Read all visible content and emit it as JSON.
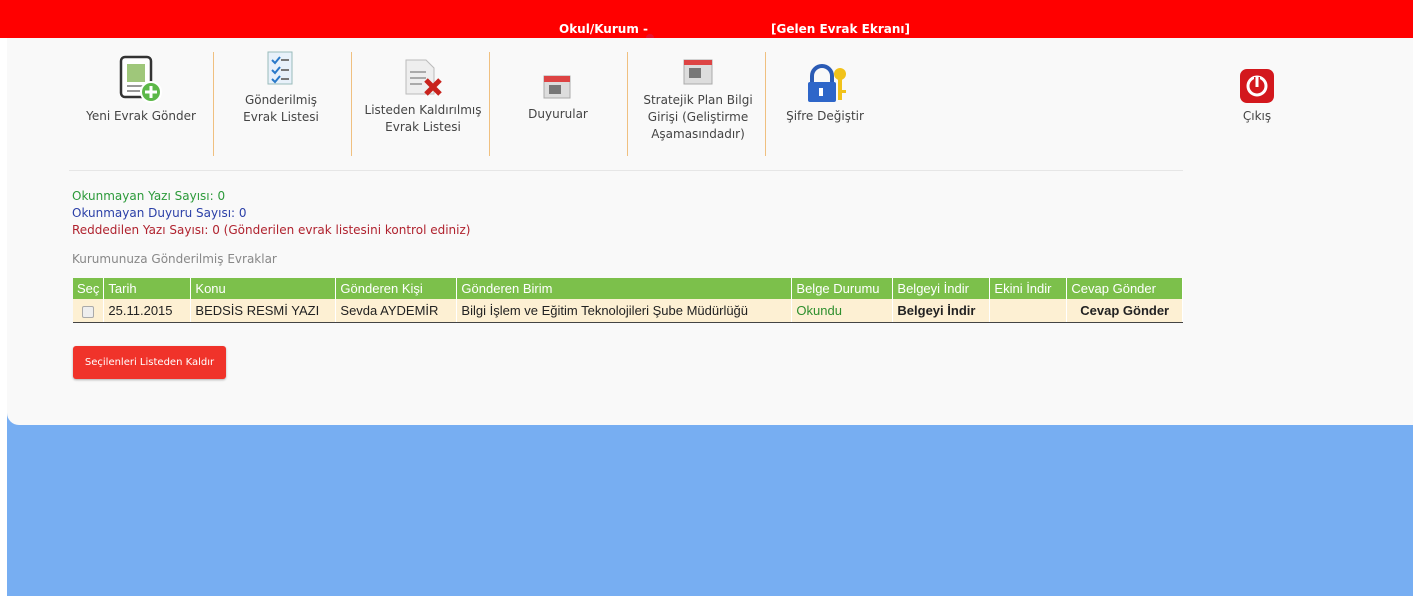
{
  "header": {
    "school_label": "Okul/Kurum -",
    "screen_label": "[Gelen Evrak Ekranı]"
  },
  "toolbar": {
    "items": [
      {
        "label": "Yeni Evrak Gönder",
        "icon": "new-document-plus-icon"
      },
      {
        "label": "Gönderilmiş Evrak Listesi",
        "icon": "checklist-document-icon"
      },
      {
        "label": "Listeden Kaldırılmış Evrak Listesi",
        "icon": "document-remove-icon"
      },
      {
        "label": "Duyurular",
        "icon": "announcement-icon"
      },
      {
        "label": "Stratejik Plan Bilgi Girişi (Geliştirme Aşamasındadır)",
        "icon": "strategic-plan-icon"
      },
      {
        "label": "Şifre Değiştir",
        "icon": "lock-key-icon"
      },
      {
        "label": "Çıkış",
        "icon": "power-icon"
      }
    ]
  },
  "stats": {
    "unread_docs": "Okunmayan Yazı Sayısı: 0",
    "unread_announcements": "Okunmayan Duyuru Sayısı: 0",
    "rejected": "Reddedilen Yazı Sayısı: 0 (Gönderilen evrak listesini kontrol ediniz)"
  },
  "table": {
    "caption": "Kurumunuza Gönderilmiş Evraklar",
    "headers": [
      "Seç",
      "Tarih",
      "Konu",
      "Gönderen Kişi",
      "Gönderen Birim",
      "Belge Durumu",
      "Belgeyi İndir",
      "Ekini İndir",
      "Cevap Gönder"
    ],
    "rows": [
      {
        "date": "25.11.2015",
        "subject": "BEDSİS RESMİ YAZI",
        "sender": "Sevda AYDEMİR",
        "unit": "Bilgi İşlem ve Eğitim Teknolojileri Şube Müdürlüğü",
        "status": "Okundu",
        "download": "Belgeyi İndir",
        "attachment": "",
        "reply": "Cevap Gönder"
      }
    ]
  },
  "remove_button": "Seçilenleri Listeden Kaldır",
  "colors": {
    "topbar": "#ff0000",
    "background": "#77aef2",
    "table_header": "#7cc04b",
    "row": "#fdf0d3",
    "button": "#f0332a"
  }
}
